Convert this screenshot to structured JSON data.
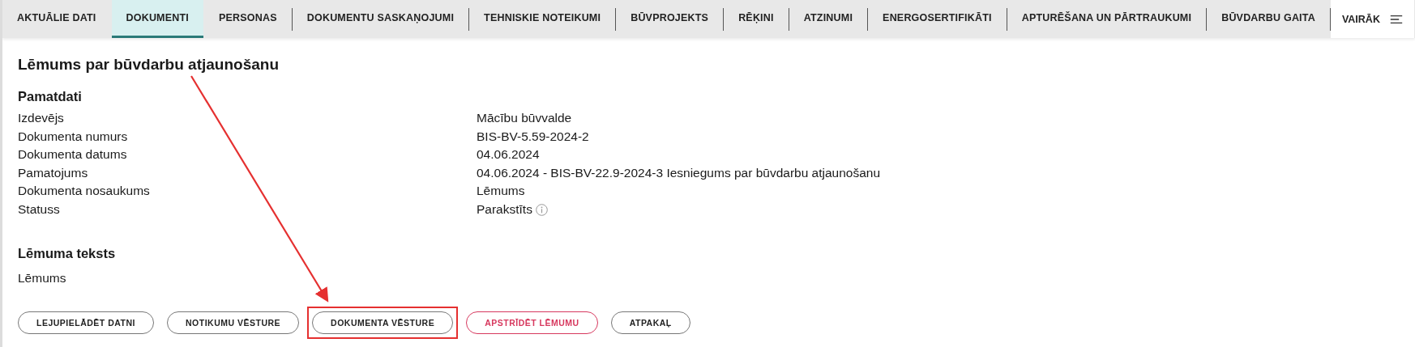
{
  "tabs": [
    {
      "label": "AKTUĀLIE DATI",
      "selected": false
    },
    {
      "label": "DOKUMENTI",
      "selected": true
    },
    {
      "label": "PERSONAS",
      "selected": false
    },
    {
      "label": "DOKUMENTU SASKAŅOJUMI",
      "selected": false
    },
    {
      "label": "TEHNISKIE NOTEIKUMI",
      "selected": false
    },
    {
      "label": "BŪVPROJEKTS",
      "selected": false
    },
    {
      "label": "RĒĶINI",
      "selected": false
    },
    {
      "label": "ATZINUMI",
      "selected": false
    },
    {
      "label": "ENERGOSERTIFIKĀTI",
      "selected": false
    },
    {
      "label": "APTURĒŠANA UN PĀRTRAUKUMI",
      "selected": false
    },
    {
      "label": "BŪVDARBU GAITA",
      "selected": false
    }
  ],
  "more_button": {
    "label": "VAIRĀK"
  },
  "title": "Lēmums par būvdarbu atjaunošanu",
  "basic_data": {
    "heading": "Pamatdati",
    "rows": [
      {
        "label": "Izdevējs",
        "value": "Mācību būvvalde"
      },
      {
        "label": "Dokumenta numurs",
        "value": "BIS-BV-5.59-2024-2"
      },
      {
        "label": "Dokumenta datums",
        "value": "04.06.2024"
      },
      {
        "label": "Pamatojums",
        "value": "04.06.2024 - BIS-BV-22.9-2024-3 Iesniegums par būvdarbu atjaunošanu"
      },
      {
        "label": "Dokumenta nosaukums",
        "value": "Lēmums"
      },
      {
        "label": "Statuss",
        "value": "Parakstīts",
        "info": true
      }
    ]
  },
  "decision_text": {
    "heading": "Lēmuma teksts",
    "body": "Lēmums"
  },
  "buttons": [
    {
      "label": "LEJUPIELĀDĒT DATNI",
      "kind": "default",
      "highlighted": false
    },
    {
      "label": "NOTIKUMU VĒSTURE",
      "kind": "default",
      "highlighted": false
    },
    {
      "label": "DOKUMENTA VĒSTURE",
      "kind": "default",
      "highlighted": true
    },
    {
      "label": "APSTRĪDĒT LĒMUMU",
      "kind": "danger",
      "highlighted": false
    },
    {
      "label": "ATPAKAĻ",
      "kind": "default",
      "highlighted": false
    }
  ]
}
